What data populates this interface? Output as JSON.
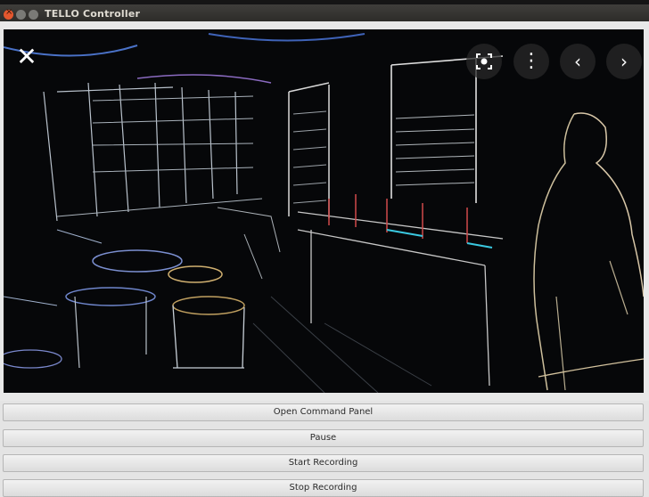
{
  "window": {
    "title": "TELLO Controller"
  },
  "overlay": {
    "close_icon": "close-icon",
    "lens_icon": "lens-icon",
    "more_icon": "more-vertical-icon",
    "prev_icon": "chevron-left-icon",
    "next_icon": "chevron-right-icon"
  },
  "buttons": {
    "command_panel": "Open Command Panel",
    "pause": "Pause",
    "start_recording": "Start Recording",
    "stop_recording": "Stop Recording"
  },
  "colors": {
    "accent_close": "#e4572e",
    "video_bg": "#050608"
  }
}
